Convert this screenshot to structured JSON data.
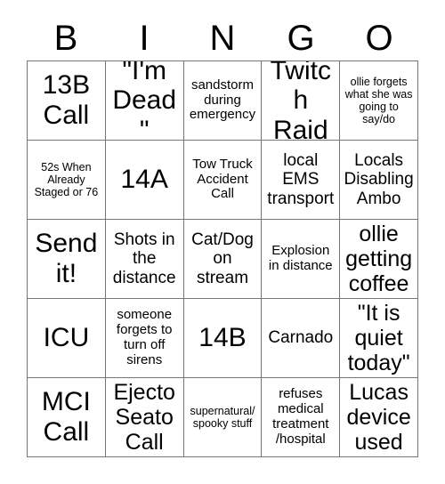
{
  "card": {
    "title": "BINGO",
    "header_letters": [
      "B",
      "I",
      "N",
      "G",
      "O"
    ],
    "grid_colors": {
      "background": "#ffffff",
      "text": "#000000",
      "border": "#777777"
    },
    "rows": 5,
    "columns": 5,
    "cells": [
      {
        "text": "13B Call",
        "size": "xl"
      },
      {
        "text": "\"I'm Dead\"",
        "size": "xl"
      },
      {
        "text": "sandstorm during emergency",
        "size": "sm"
      },
      {
        "text": "Twitch Raid",
        "size": "xl"
      },
      {
        "text": "ollie forgets what she was going to say/do",
        "size": "xs"
      },
      {
        "text": "52s When Already Staged or 76",
        "size": "xs"
      },
      {
        "text": "14A",
        "size": "xl"
      },
      {
        "text": "Tow Truck Accident Call",
        "size": "sm"
      },
      {
        "text": "local EMS transport",
        "size": "md"
      },
      {
        "text": "Locals Disabling Ambo",
        "size": "md"
      },
      {
        "text": "Send it!",
        "size": "xl"
      },
      {
        "text": "Shots in the distance",
        "size": "md"
      },
      {
        "text": "Cat/Dog on stream",
        "size": "md"
      },
      {
        "text": "Explosion in distance",
        "size": "sm"
      },
      {
        "text": "ollie getting coffee",
        "size": "lg"
      },
      {
        "text": "ICU",
        "size": "xl"
      },
      {
        "text": "someone forgets to turn off sirens",
        "size": "sm"
      },
      {
        "text": "14B",
        "size": "xl"
      },
      {
        "text": "Carnado",
        "size": "md"
      },
      {
        "text": "\"It is quiet today\"",
        "size": "lg"
      },
      {
        "text": "MCI Call",
        "size": "xl"
      },
      {
        "text": "Ejecto Seato Call",
        "size": "lg"
      },
      {
        "text": "supernatural/ spooky stuff",
        "size": "xs"
      },
      {
        "text": "refuses medical treatment /hospital",
        "size": "sm"
      },
      {
        "text": "Lucas device used",
        "size": "lg"
      }
    ]
  }
}
